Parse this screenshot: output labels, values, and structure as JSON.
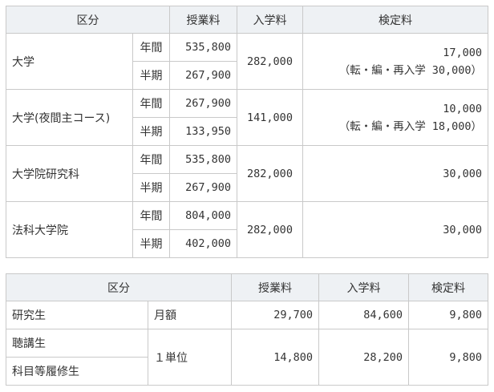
{
  "table1": {
    "headers": {
      "category": "区分",
      "tuition": "授業料",
      "admission": "入学料",
      "exam": "検定料"
    },
    "rows": [
      {
        "name": "大学",
        "annual_label": "年間",
        "annual": "535,800",
        "half_label": "半期",
        "half": "267,900",
        "admission": "282,000",
        "exam_main": "17,000",
        "exam_note_label": "（転・編・再入学",
        "exam_note_value": "30,000）"
      },
      {
        "name": "大学(夜間主コース)",
        "annual_label": "年間",
        "annual": "267,900",
        "half_label": "半期",
        "half": "133,950",
        "admission": "141,000",
        "exam_main": "10,000",
        "exam_note_label": "（転・編・再入学",
        "exam_note_value": "18,000）"
      },
      {
        "name": "大学院研究科",
        "annual_label": "年間",
        "annual": "535,800",
        "half_label": "半期",
        "half": "267,900",
        "admission": "282,000",
        "exam_main": "30,000"
      },
      {
        "name": "法科大学院",
        "annual_label": "年間",
        "annual": "804,000",
        "half_label": "半期",
        "half": "402,000",
        "admission": "282,000",
        "exam_main": "30,000"
      }
    ]
  },
  "table2": {
    "headers": {
      "category": "区分",
      "tuition": "授業料",
      "admission": "入学料",
      "exam": "検定料"
    },
    "rows": [
      {
        "name": "研究生",
        "unit": "月額",
        "tuition": "29,700",
        "admission": "84,600",
        "exam": "9,800"
      },
      {
        "name": "聴講生",
        "name2": "科目等履修生",
        "unit": "１単位",
        "tuition": "14,800",
        "admission": "28,200",
        "exam": "9,800"
      }
    ]
  },
  "colors": {
    "header_bg": "#eef1f4",
    "border": "#c9c9c9",
    "text": "#333333"
  }
}
